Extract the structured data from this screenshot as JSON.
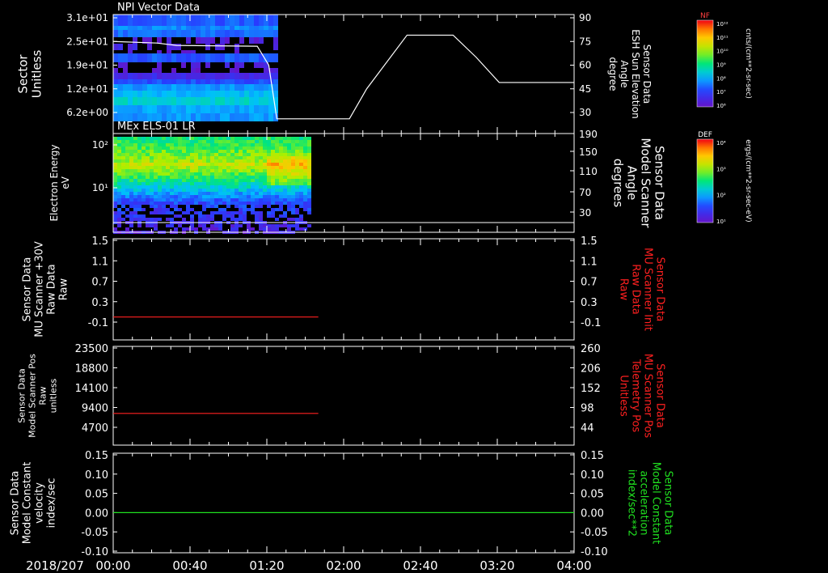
{
  "date_label": "2018/207",
  "x_ticks": [
    "00:00",
    "00:40",
    "01:20",
    "02:00",
    "02:40",
    "03:20",
    "04:00"
  ],
  "colors": {
    "background": "#000000",
    "axes": "#ffffff",
    "sun_line": "#ffffff",
    "red_trace": "#ff2020",
    "green_trace": "#20e020",
    "red_label": "#ff2020",
    "green_label": "#20e020"
  },
  "colorbars": [
    {
      "title": "NF",
      "tick_labels": [
        "10¹²",
        "10¹¹",
        "10¹⁰",
        "10⁹",
        "10⁸",
        "10⁷",
        "10⁶"
      ],
      "unit_label": "cnts/(cm**2-sr-sec)"
    },
    {
      "title": "DEF",
      "tick_labels": [
        "10⁴",
        "10³",
        "10²",
        "10¹"
      ],
      "unit_label": "ergs/(cm**2-sr-sec-eV)"
    }
  ],
  "chart_data": [
    {
      "type": "heatmap",
      "title": "NPI Vector Data",
      "ylabel_lines": [
        "Sector",
        "Unitless"
      ],
      "yticks_left": [
        "3.1e+01",
        "2.5e+01",
        "1.9e+01",
        "1.2e+01",
        "6.2e+00"
      ],
      "y2label_lines": [
        "Sensor Data",
        "ESH Sun Elevation",
        "Angle",
        "degree"
      ],
      "yticks_right": [
        "90",
        "75",
        "60",
        "45",
        "30"
      ],
      "xlim_hours": [
        0,
        4
      ],
      "data_end_hours": 1.42,
      "overlay_line": {
        "name": "ESH Sun Elevation Angle",
        "ylim": [
          17,
          90
        ],
        "x_hours": [
          0,
          0.38,
          0.55,
          1.25,
          1.35,
          1.42,
          2.05,
          2.2,
          2.55,
          2.95,
          3.15,
          3.35,
          4.0
        ],
        "y_deg": [
          75,
          74,
          72.5,
          72,
          60,
          26,
          26,
          45,
          79,
          79,
          65,
          49,
          49
        ]
      }
    },
    {
      "type": "heatmap",
      "title": "MEx ELS-01 LR",
      "ylabel_lines": [
        "Electron Energy",
        "eV"
      ],
      "yticks_left": [
        "10²",
        "10¹"
      ],
      "y2label_lines": [
        "Sensor Data",
        "Model Scanner",
        "Angle",
        "degrees"
      ],
      "yticks_right": [
        "190",
        "150",
        "110",
        "70",
        "30"
      ],
      "xlim_hours": [
        0,
        4
      ],
      "data_end_hours": 1.7,
      "overlay_line": {
        "name": "Model Scanner Angle",
        "ylim": [
          -7,
          190
        ],
        "x_hours": [
          0,
          4
        ],
        "y_deg": [
          10,
          10
        ]
      }
    },
    {
      "type": "line",
      "ylabel_lines": [
        "Sensor Data",
        "MU Scanner +30V",
        "Raw Data",
        "Raw"
      ],
      "y2label_lines": [
        "Sensor Data",
        "MU Scanner Init",
        "Raw Data",
        "Raw"
      ],
      "yticks_left": [
        "1.5",
        "1.1",
        "0.7",
        "0.3",
        "-0.1"
      ],
      "yticks_right": [
        "1.5",
        "1.1",
        "0.7",
        "0.3",
        "-0.1"
      ],
      "ylim": [
        -0.3,
        1.5
      ],
      "series": [
        {
          "x_hours": [
            0,
            1.78
          ],
          "y": [
            0.0,
            0.0
          ]
        }
      ]
    },
    {
      "type": "line",
      "ylabel_lines": [
        "Sensor Data",
        "Model Scanner Pos",
        "Raw",
        "unitless"
      ],
      "y2label_lines": [
        "Sensor Data",
        "MU Scanner Pos",
        "Telemetry Pos",
        "Unitless"
      ],
      "yticks_left": [
        "23500",
        "18800",
        "14100",
        "9400",
        "4700"
      ],
      "yticks_right": [
        "260",
        "206",
        "152",
        "98",
        "44"
      ],
      "ylim": [
        0,
        23500
      ],
      "series": [
        {
          "x_hours": [
            0,
            1.78
          ],
          "y": [
            8000,
            8000
          ]
        }
      ]
    },
    {
      "type": "line",
      "ylabel_lines": [
        "Sensor Data",
        "Model Constant",
        "velocity",
        "index/sec"
      ],
      "y2label_lines": [
        "Sensor Data",
        "Model Constant",
        "acceleration",
        "index/sec**2"
      ],
      "yticks_left": [
        "0.15",
        "0.10",
        "0.05",
        "0.00",
        "-0.05",
        "-0.10"
      ],
      "yticks_right": [
        "0.15",
        "0.10",
        "0.05",
        "0.00",
        "-0.05",
        "-0.10"
      ],
      "ylim": [
        -0.1,
        0.15
      ],
      "series": [
        {
          "x_hours": [
            0,
            4
          ],
          "y": [
            0.0,
            0.0
          ]
        }
      ]
    }
  ]
}
